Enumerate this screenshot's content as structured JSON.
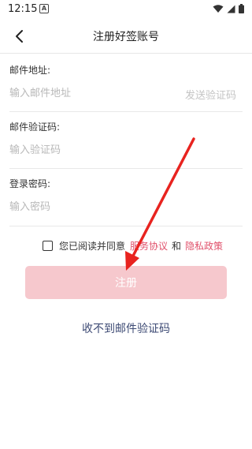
{
  "status_bar": {
    "time": "12:15",
    "app_badge": "A",
    "icons": [
      "wifi-icon",
      "signal-icon",
      "battery-icon"
    ]
  },
  "header": {
    "title": "注册好签账号",
    "back_icon": "chevron-left-icon"
  },
  "form": {
    "email": {
      "label": "邮件地址:",
      "placeholder": "输入邮件地址",
      "send_code_label": "发送验证码"
    },
    "code": {
      "label": "邮件验证码:",
      "placeholder": "输入验证码"
    },
    "password": {
      "label": "登录密码:",
      "placeholder": "输入密码"
    }
  },
  "agreement": {
    "prefix": "您已阅读并同意",
    "terms_link": "服务协议",
    "and": "和",
    "privacy_link": "隐私政策"
  },
  "register_button": {
    "label": "注册"
  },
  "no_code_link": {
    "label": "收不到邮件验证码"
  },
  "colors": {
    "accent": "#e0506a",
    "button_disabled": "#f6c8cd",
    "link": "#3d4a74",
    "annotation_arrow": "#e8231f"
  }
}
